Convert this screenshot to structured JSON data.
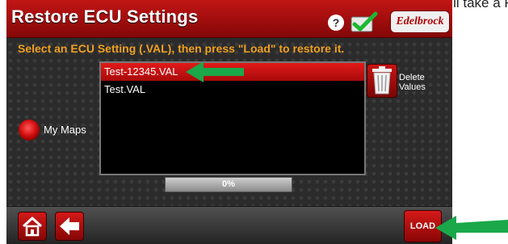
{
  "caption": "button to upload the ECU Settings.  This will take a R",
  "window": {
    "title": "Restore ECU Settings",
    "help_label": "?",
    "brand_logo": "Edelbrock"
  },
  "instruction": "Select an ECU Setting (.VAL), then press \"Load\" to restore it.",
  "files": [
    {
      "name": "Test-12345.VAL",
      "selected": true
    },
    {
      "name": "Test.VAL",
      "selected": false
    }
  ],
  "delete": {
    "line1": "Delete",
    "line2": "Values",
    "icon": "trash-can-icon"
  },
  "my_maps": {
    "label": "My Maps"
  },
  "progress": {
    "text": "0%",
    "value": 0
  },
  "load_label": "LOAD",
  "colors": {
    "accent_red": "#c11515",
    "instruction_orange": "#f0a020",
    "annotation_green": "#1aa84a"
  },
  "icons": [
    "help-icon",
    "checkmark-icon",
    "home-icon",
    "back-arrow-icon",
    "trash-can-icon"
  ]
}
